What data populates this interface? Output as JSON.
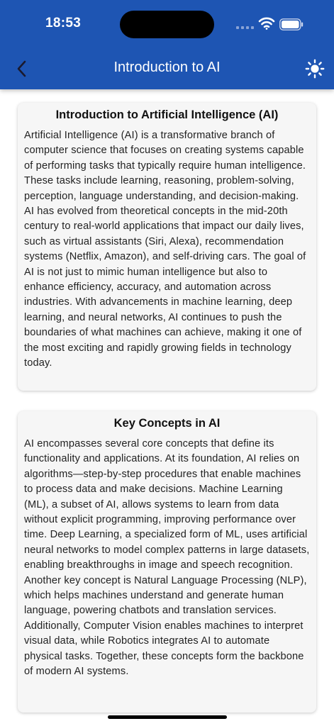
{
  "status_bar": {
    "time": "18:53"
  },
  "header": {
    "title": "Introduction to AI",
    "back_icon": "chevron-left-icon",
    "theme_icon": "sun-icon"
  },
  "colors": {
    "header_bg": "#1e55b3",
    "card_bg": "#f6f6f6"
  },
  "cards": [
    {
      "title": "Introduction to Artificial Intelligence (AI)",
      "body": "Artificial Intelligence (AI) is a transformative branch of computer science that focuses on creating systems capable of performing tasks that typically require human intelligence. These tasks include learning, reasoning, problem-solving, perception, language understanding, and decision-making. AI has evolved from theoretical concepts in the mid-20th century to real-world applications that impact our daily lives, such as virtual assistants (Siri, Alexa), recommendation systems (Netflix, Amazon), and self-driving cars. The goal of AI is not just to mimic human intelligence but also to enhance efficiency, accuracy, and automation across industries. With advancements in machine learning, deep learning, and neural networks, AI continues to push the boundaries of what machines can achieve, making it one of the most exciting and rapidly growing fields in technology today."
    },
    {
      "title": "Key Concepts in AI",
      "body": "AI encompasses several core concepts that define its functionality and applications. At its foundation, AI relies on algorithms—step-by-step procedures that enable machines to process data and make decisions. Machine Learning (ML), a subset of AI, allows systems to learn from data without explicit programming, improving performance over time. Deep Learning, a specialized form of ML, uses artificial neural networks to model complex patterns in large datasets, enabling breakthroughs in image and speech recognition. Another key concept is Natural Language Processing (NLP), which helps machines understand and generate human language, powering chatbots and translation services. Additionally, Computer Vision enables machines to interpret visual data, while Robotics integrates AI to automate physical tasks. Together, these concepts form the backbone of modern AI systems."
    }
  ]
}
